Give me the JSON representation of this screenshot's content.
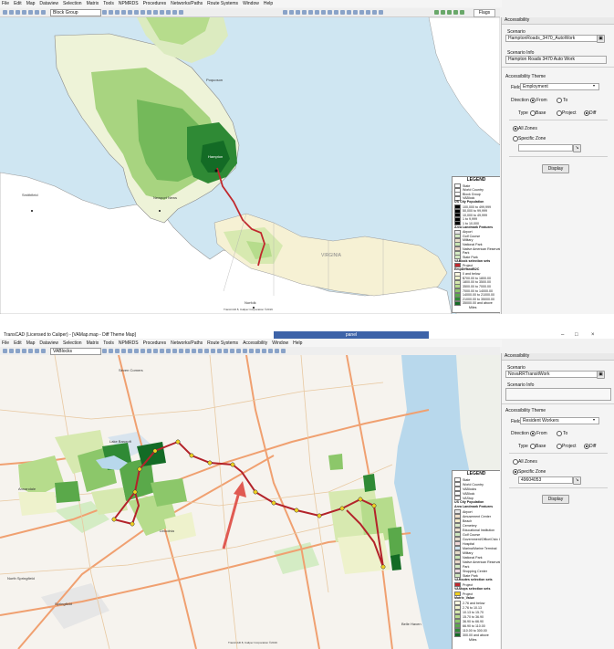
{
  "top": {
    "menu": [
      "File",
      "Edit",
      "Map",
      "Dataview",
      "Selection",
      "Matrix",
      "Tools",
      "NPMRDS",
      "Procedures",
      "Networks/Paths",
      "Route Systems",
      "Window",
      "Help"
    ],
    "layer_select": "Block Group",
    "flags_tab": "Flags",
    "panel": {
      "title": "Accessibility",
      "scenario_label": "Scenario",
      "scenario_value": "HamptonRoads_3470_AutoWork",
      "scenario_info_label": "Scenario Info",
      "scenario_info_value": "Hampton Roads 3470 Auto Work",
      "theme_label": "Accessibility Theme",
      "field_label": "Field",
      "field_value": "Employment",
      "direction_label": "Direction",
      "dir_from": "From",
      "dir_to": "To",
      "type_label": "Type",
      "type_base": "Base",
      "type_project": "Project",
      "type_diff": "Diff",
      "all_zones": "All Zones",
      "specific_zone": "Specific Zone",
      "zone_value": "",
      "display_button": "Display"
    },
    "legend": {
      "title": "LEGEND",
      "rows": [
        {
          "text": "State",
          "color": "#ffffff"
        },
        {
          "text": "World Country",
          "color": "#ffffff"
        },
        {
          "text": "Block Group",
          "color": "#ffffff"
        },
        {
          "text": "VABlock",
          "color": "#ffffff"
        },
        {
          "text": "US City Population",
          "head": true
        },
        {
          "text": "100,000 to 499,999",
          "color": "#000000"
        },
        {
          "text": "50,000 to 99,999",
          "color": "#000000"
        },
        {
          "text": "10,000 to 49,999",
          "color": "#000000"
        },
        {
          "text": "1 to 9,999",
          "color": "#000000"
        },
        {
          "text": "1 to 10,000",
          "color": "#000000"
        },
        {
          "text": "Area Landmark Features",
          "head": true
        },
        {
          "text": "Airport",
          "color": "#e8e8e8"
        },
        {
          "text": "Golf Course",
          "color": "#cfe8c0"
        },
        {
          "text": "Military",
          "color": "#e6dcc8"
        },
        {
          "text": "National Park",
          "color": "#c8e6b4"
        },
        {
          "text": "Native American Reservation",
          "color": "#e8d8c8"
        },
        {
          "text": "Park",
          "color": "#d4ecc4"
        },
        {
          "text": "State Park",
          "color": "#d0e8c0"
        },
        {
          "text": "VABlock selection sets",
          "head": true
        },
        {
          "text": "Project",
          "color": "#c0282d"
        },
        {
          "text": "EmpDiffandB2C",
          "head": true
        },
        {
          "text": "0 and below",
          "color": "#fbf8e0"
        },
        {
          "text": "$700.00 to 1800.00",
          "color": "#eef2cc"
        },
        {
          "text": "1800.00 to 3500.00",
          "color": "#d7e9b0"
        },
        {
          "text": "3500.00 to 7000.00",
          "color": "#b6dc8c"
        },
        {
          "text": "7000.00 to 14000.00",
          "color": "#8cc76a"
        },
        {
          "text": "14000.00 to 21000.00",
          "color": "#5aa94a"
        },
        {
          "text": "21000.00 to 35000.00",
          "color": "#2f8a35"
        },
        {
          "text": "35000.00 and above",
          "color": "#136b25"
        }
      ],
      "scale": "Miles"
    },
    "labels": {
      "norfolk": "Norfolk",
      "newport": "Newport News",
      "virginia": "VIRGINIA",
      "hampton": "Hampton",
      "poquoson": "Poquoson",
      "smithfield": "Smithfield",
      "copyright": "TransCAD 8, Caliper Corporation ©2019"
    }
  },
  "bottom": {
    "window_title": "TransCAD (Licensed to Caliper) - [VAMap.map - Diff Theme Map]",
    "sub_title": "panel",
    "menu": [
      "File",
      "Edit",
      "Map",
      "Dataview",
      "Selection",
      "Matrix",
      "Tools",
      "NPMRDS",
      "Procedures",
      "Networks/Paths",
      "Route Systems",
      "Accessibility",
      "Window",
      "Help"
    ],
    "layer_select": "VABlocks",
    "panel": {
      "title": "Accessibility",
      "scenario_label": "Scenario",
      "scenario_value": "NovaRRTransitWork",
      "scenario_info_label": "Scenario Info",
      "scenario_info_value": "",
      "theme_label": "Accessibility Theme",
      "field_label": "Field",
      "field_value": "Resident Workers",
      "direction_label": "Direction",
      "dir_from": "From",
      "dir_to": "To",
      "type_label": "Type",
      "type_base": "Base",
      "type_project": "Project",
      "type_diff": "Diff",
      "all_zones": "All Zones",
      "specific_zone": "Specific Zone",
      "zone_value": "49604053",
      "display_button": "Display"
    },
    "legend": {
      "title": "LEGEND",
      "rows": [
        {
          "text": "State",
          "color": "#ffffff"
        },
        {
          "text": "World Country",
          "color": "#ffffff"
        },
        {
          "text": "VABlocks",
          "color": "#ffffff"
        },
        {
          "text": "VABlock",
          "color": "#ffffff"
        },
        {
          "text": "VAStop",
          "color": "#ffffff"
        },
        {
          "text": "US City Population",
          "head": true
        },
        {
          "text": "Area Landmark Features",
          "head": true
        },
        {
          "text": "Airport",
          "color": "#e8e8e8"
        },
        {
          "text": "Amusement Center",
          "color": "#f0e0c8"
        },
        {
          "text": "Beach",
          "color": "#f4ecc8"
        },
        {
          "text": "Cemetery",
          "color": "#d8e8c8"
        },
        {
          "text": "Educational Institution",
          "color": "#ece0d0"
        },
        {
          "text": "Golf Course",
          "color": "#cfe8c0"
        },
        {
          "text": "Government/Office/Civic Center",
          "color": "#e4dccc"
        },
        {
          "text": "Hospital",
          "color": "#f0d8d8"
        },
        {
          "text": "Marina/Marine Terminal",
          "color": "#d0e4f0"
        },
        {
          "text": "Military",
          "color": "#e6dcc8"
        },
        {
          "text": "National Park",
          "color": "#c8e6b4"
        },
        {
          "text": "Native American Reservation",
          "color": "#e8d8c8"
        },
        {
          "text": "Park",
          "color": "#d4ecc4"
        },
        {
          "text": "Shopping Center",
          "color": "#ecd8e0"
        },
        {
          "text": "State Park",
          "color": "#d0e8c0"
        },
        {
          "text": "VARoutes selection sets",
          "head": true
        },
        {
          "text": "Project",
          "color": "#c0282d"
        },
        {
          "text": "VAStops selection sets",
          "head": true
        },
        {
          "text": "Project",
          "color": "#f0d020"
        },
        {
          "text": "Matrix_Value",
          "head": true
        },
        {
          "text": "2.76 and below",
          "color": "#fbf8e0"
        },
        {
          "text": "2.76 to 10.13",
          "color": "#eef2cc"
        },
        {
          "text": "10.13 to 15.70",
          "color": "#d7e9b0"
        },
        {
          "text": "15.70 to 36.90",
          "color": "#b6dc8c"
        },
        {
          "text": "36.90 to 66.90",
          "color": "#8cc76a"
        },
        {
          "text": "66.90 to 110.00",
          "color": "#5aa94a"
        },
        {
          "text": "110.00 to 300.00",
          "color": "#2f8a35"
        },
        {
          "text": "300.00 and above",
          "color": "#136b25"
        }
      ],
      "scale": "Miles"
    },
    "labels": {
      "seven_corners": "Seven Corners",
      "lake_barcroft": "Lake Barcroft",
      "annandale": "Annandale",
      "lincolnia": "Lincolnia",
      "north_springfield": "North Springfield",
      "springfield": "Springfield",
      "belle_haven": "Belle Haven",
      "copyright": "TransCAD 8, Caliper Corporation ©2019"
    }
  }
}
